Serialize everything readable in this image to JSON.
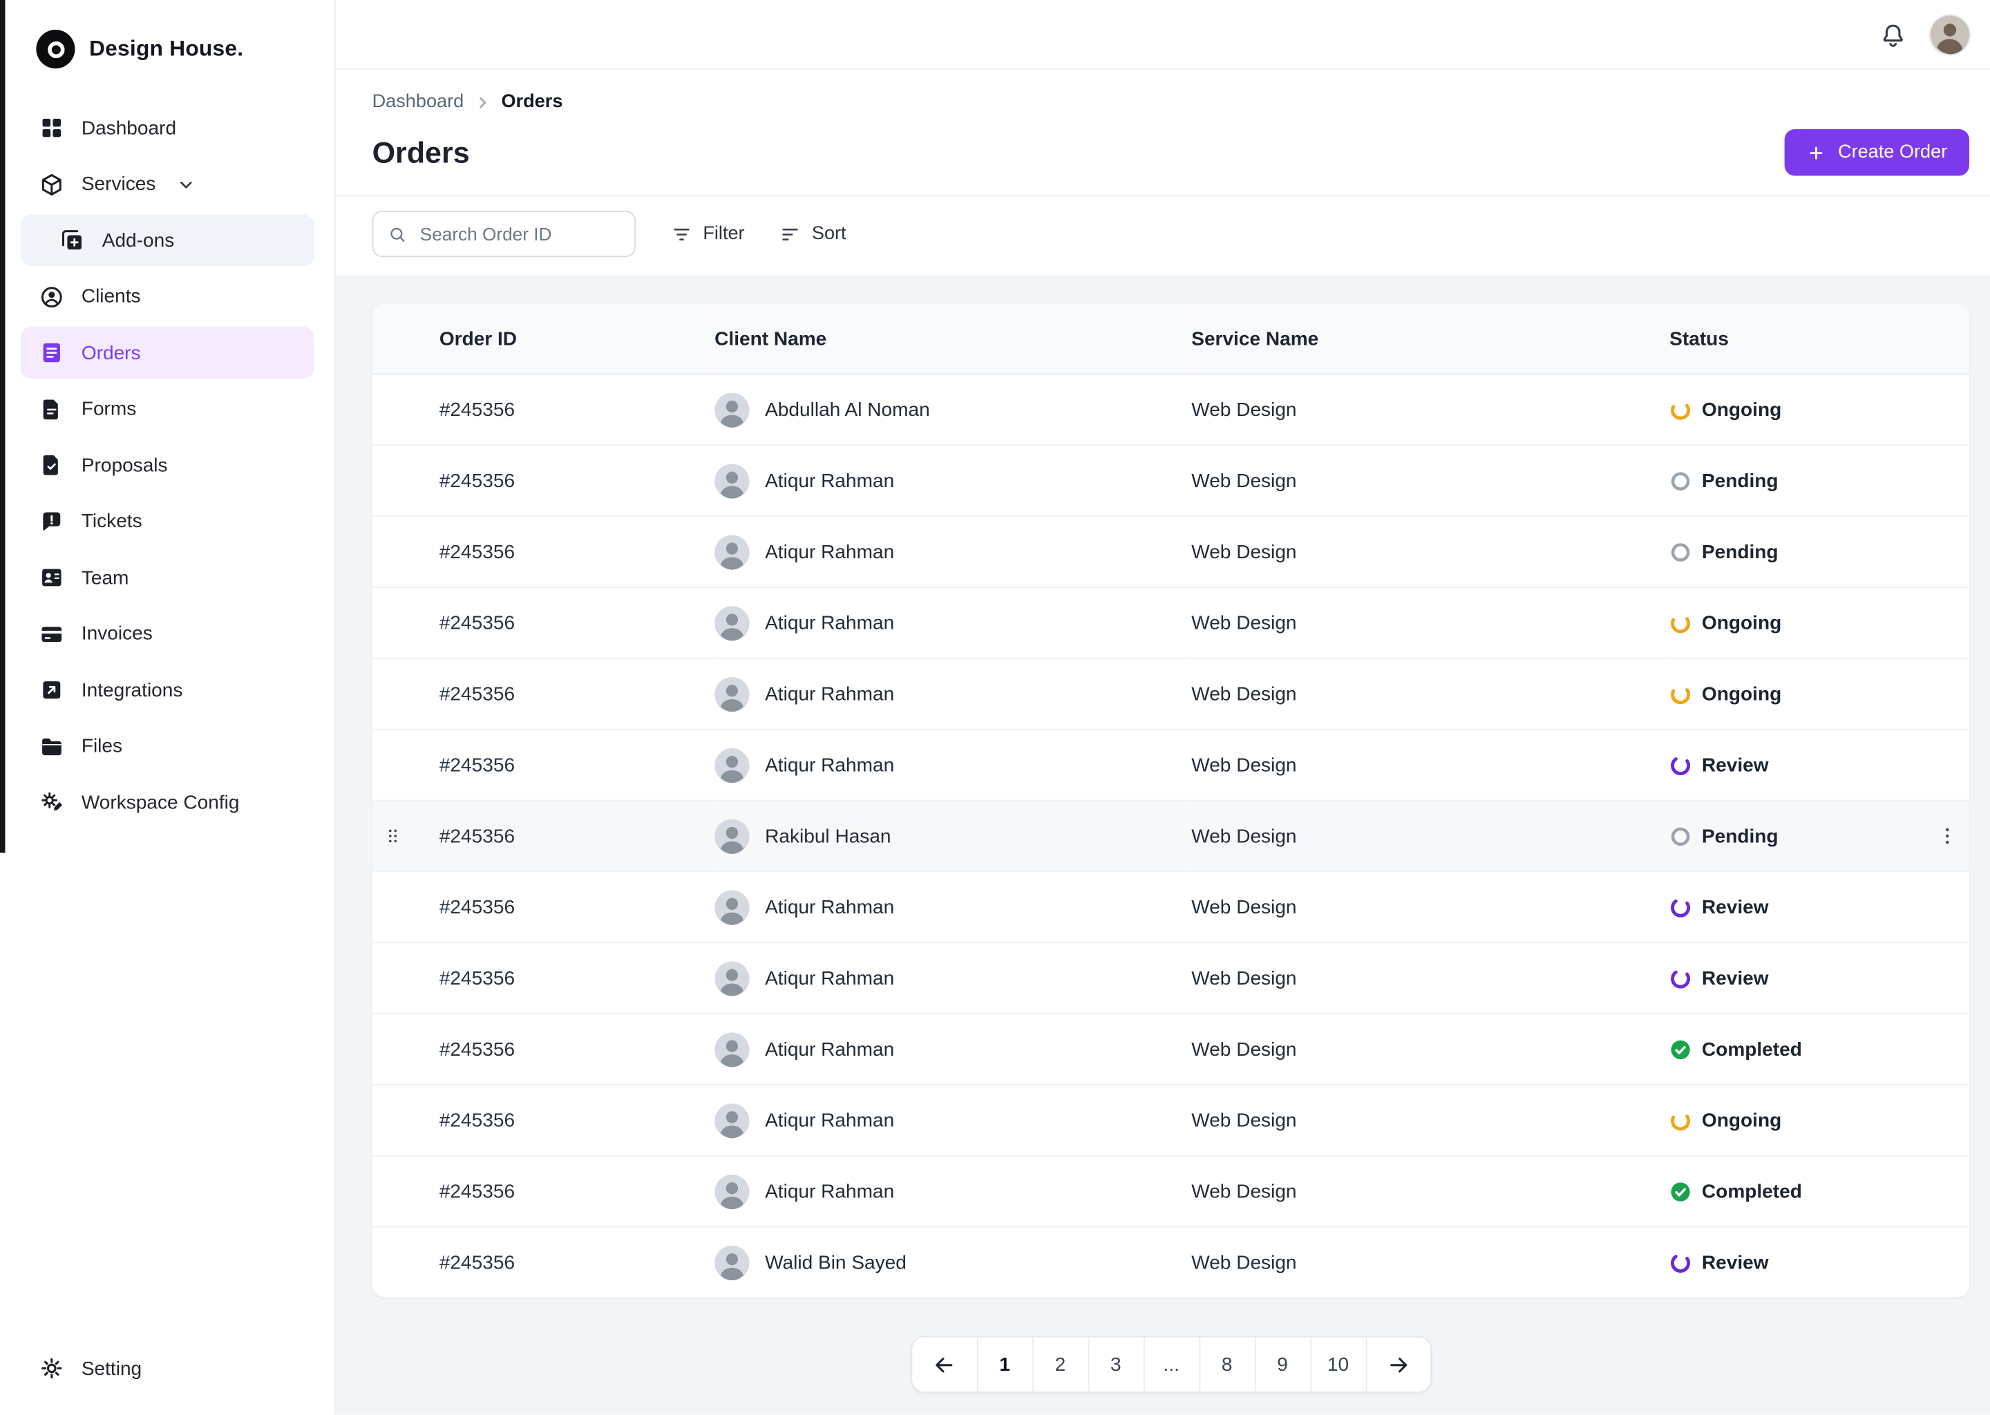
{
  "brand": {
    "name": "Design House."
  },
  "breadcrumb": {
    "items": [
      "Dashboard",
      "Orders"
    ]
  },
  "page": {
    "title": "Orders",
    "create_order_label": "Create Order"
  },
  "toolbar": {
    "search_placeholder": "Search Order ID",
    "filter_label": "Filter",
    "sort_label": "Sort"
  },
  "sidebar": {
    "items": [
      {
        "label": "Dashboard",
        "icon": "dashboard-icon"
      },
      {
        "label": "Services",
        "icon": "services-icon",
        "chevron": true
      },
      {
        "label": "Add-ons",
        "icon": "add-ons-icon",
        "sub": true
      },
      {
        "label": "Clients",
        "icon": "clients-icon"
      },
      {
        "label": "Orders",
        "icon": "orders-icon",
        "active": true
      },
      {
        "label": "Forms",
        "icon": "forms-icon"
      },
      {
        "label": "Proposals",
        "icon": "proposals-icon"
      },
      {
        "label": "Tickets",
        "icon": "tickets-icon"
      },
      {
        "label": "Team",
        "icon": "team-icon"
      },
      {
        "label": "Invoices",
        "icon": "invoices-icon"
      },
      {
        "label": "Integrations",
        "icon": "integrations-icon"
      },
      {
        "label": "Files",
        "icon": "files-icon"
      },
      {
        "label": "Workspace Config",
        "icon": "workspace-config-icon"
      }
    ],
    "footer": {
      "label": "Setting",
      "icon": "setting-icon"
    }
  },
  "table": {
    "columns": [
      "Order ID",
      "Client Name",
      "Service Name",
      "Status"
    ],
    "rows": [
      {
        "order_id": "#245356",
        "client": "Abdullah Al Noman",
        "service": "Web Design",
        "status": "Ongoing"
      },
      {
        "order_id": "#245356",
        "client": "Atiqur Rahman",
        "service": "Web Design",
        "status": "Pending"
      },
      {
        "order_id": "#245356",
        "client": "Atiqur Rahman",
        "service": "Web Design",
        "status": "Pending"
      },
      {
        "order_id": "#245356",
        "client": "Atiqur Rahman",
        "service": "Web Design",
        "status": "Ongoing"
      },
      {
        "order_id": "#245356",
        "client": "Atiqur Rahman",
        "service": "Web Design",
        "status": "Ongoing"
      },
      {
        "order_id": "#245356",
        "client": "Atiqur Rahman",
        "service": "Web Design",
        "status": "Review"
      },
      {
        "order_id": "#245356",
        "client": "Rakibul Hasan",
        "service": "Web Design",
        "status": "Pending",
        "highlighted": true
      },
      {
        "order_id": "#245356",
        "client": "Atiqur Rahman",
        "service": "Web Design",
        "status": "Review"
      },
      {
        "order_id": "#245356",
        "client": "Atiqur Rahman",
        "service": "Web Design",
        "status": "Review"
      },
      {
        "order_id": "#245356",
        "client": "Atiqur Rahman",
        "service": "Web Design",
        "status": "Completed"
      },
      {
        "order_id": "#245356",
        "client": "Atiqur Rahman",
        "service": "Web Design",
        "status": "Ongoing"
      },
      {
        "order_id": "#245356",
        "client": "Atiqur Rahman",
        "service": "Web Design",
        "status": "Completed"
      },
      {
        "order_id": "#245356",
        "client": "Walid Bin Sayed",
        "service": "Web Design",
        "status": "Review"
      }
    ]
  },
  "pagination": {
    "pages": [
      "1",
      "2",
      "3",
      "...",
      "8",
      "9",
      "10"
    ],
    "active_page": "1"
  },
  "colors": {
    "accent": "#7c3aed",
    "status": {
      "Ongoing": "#f0a417",
      "Pending": "#9aa3ad",
      "Review": "#6d28d9",
      "Completed": "#17a34a"
    }
  }
}
